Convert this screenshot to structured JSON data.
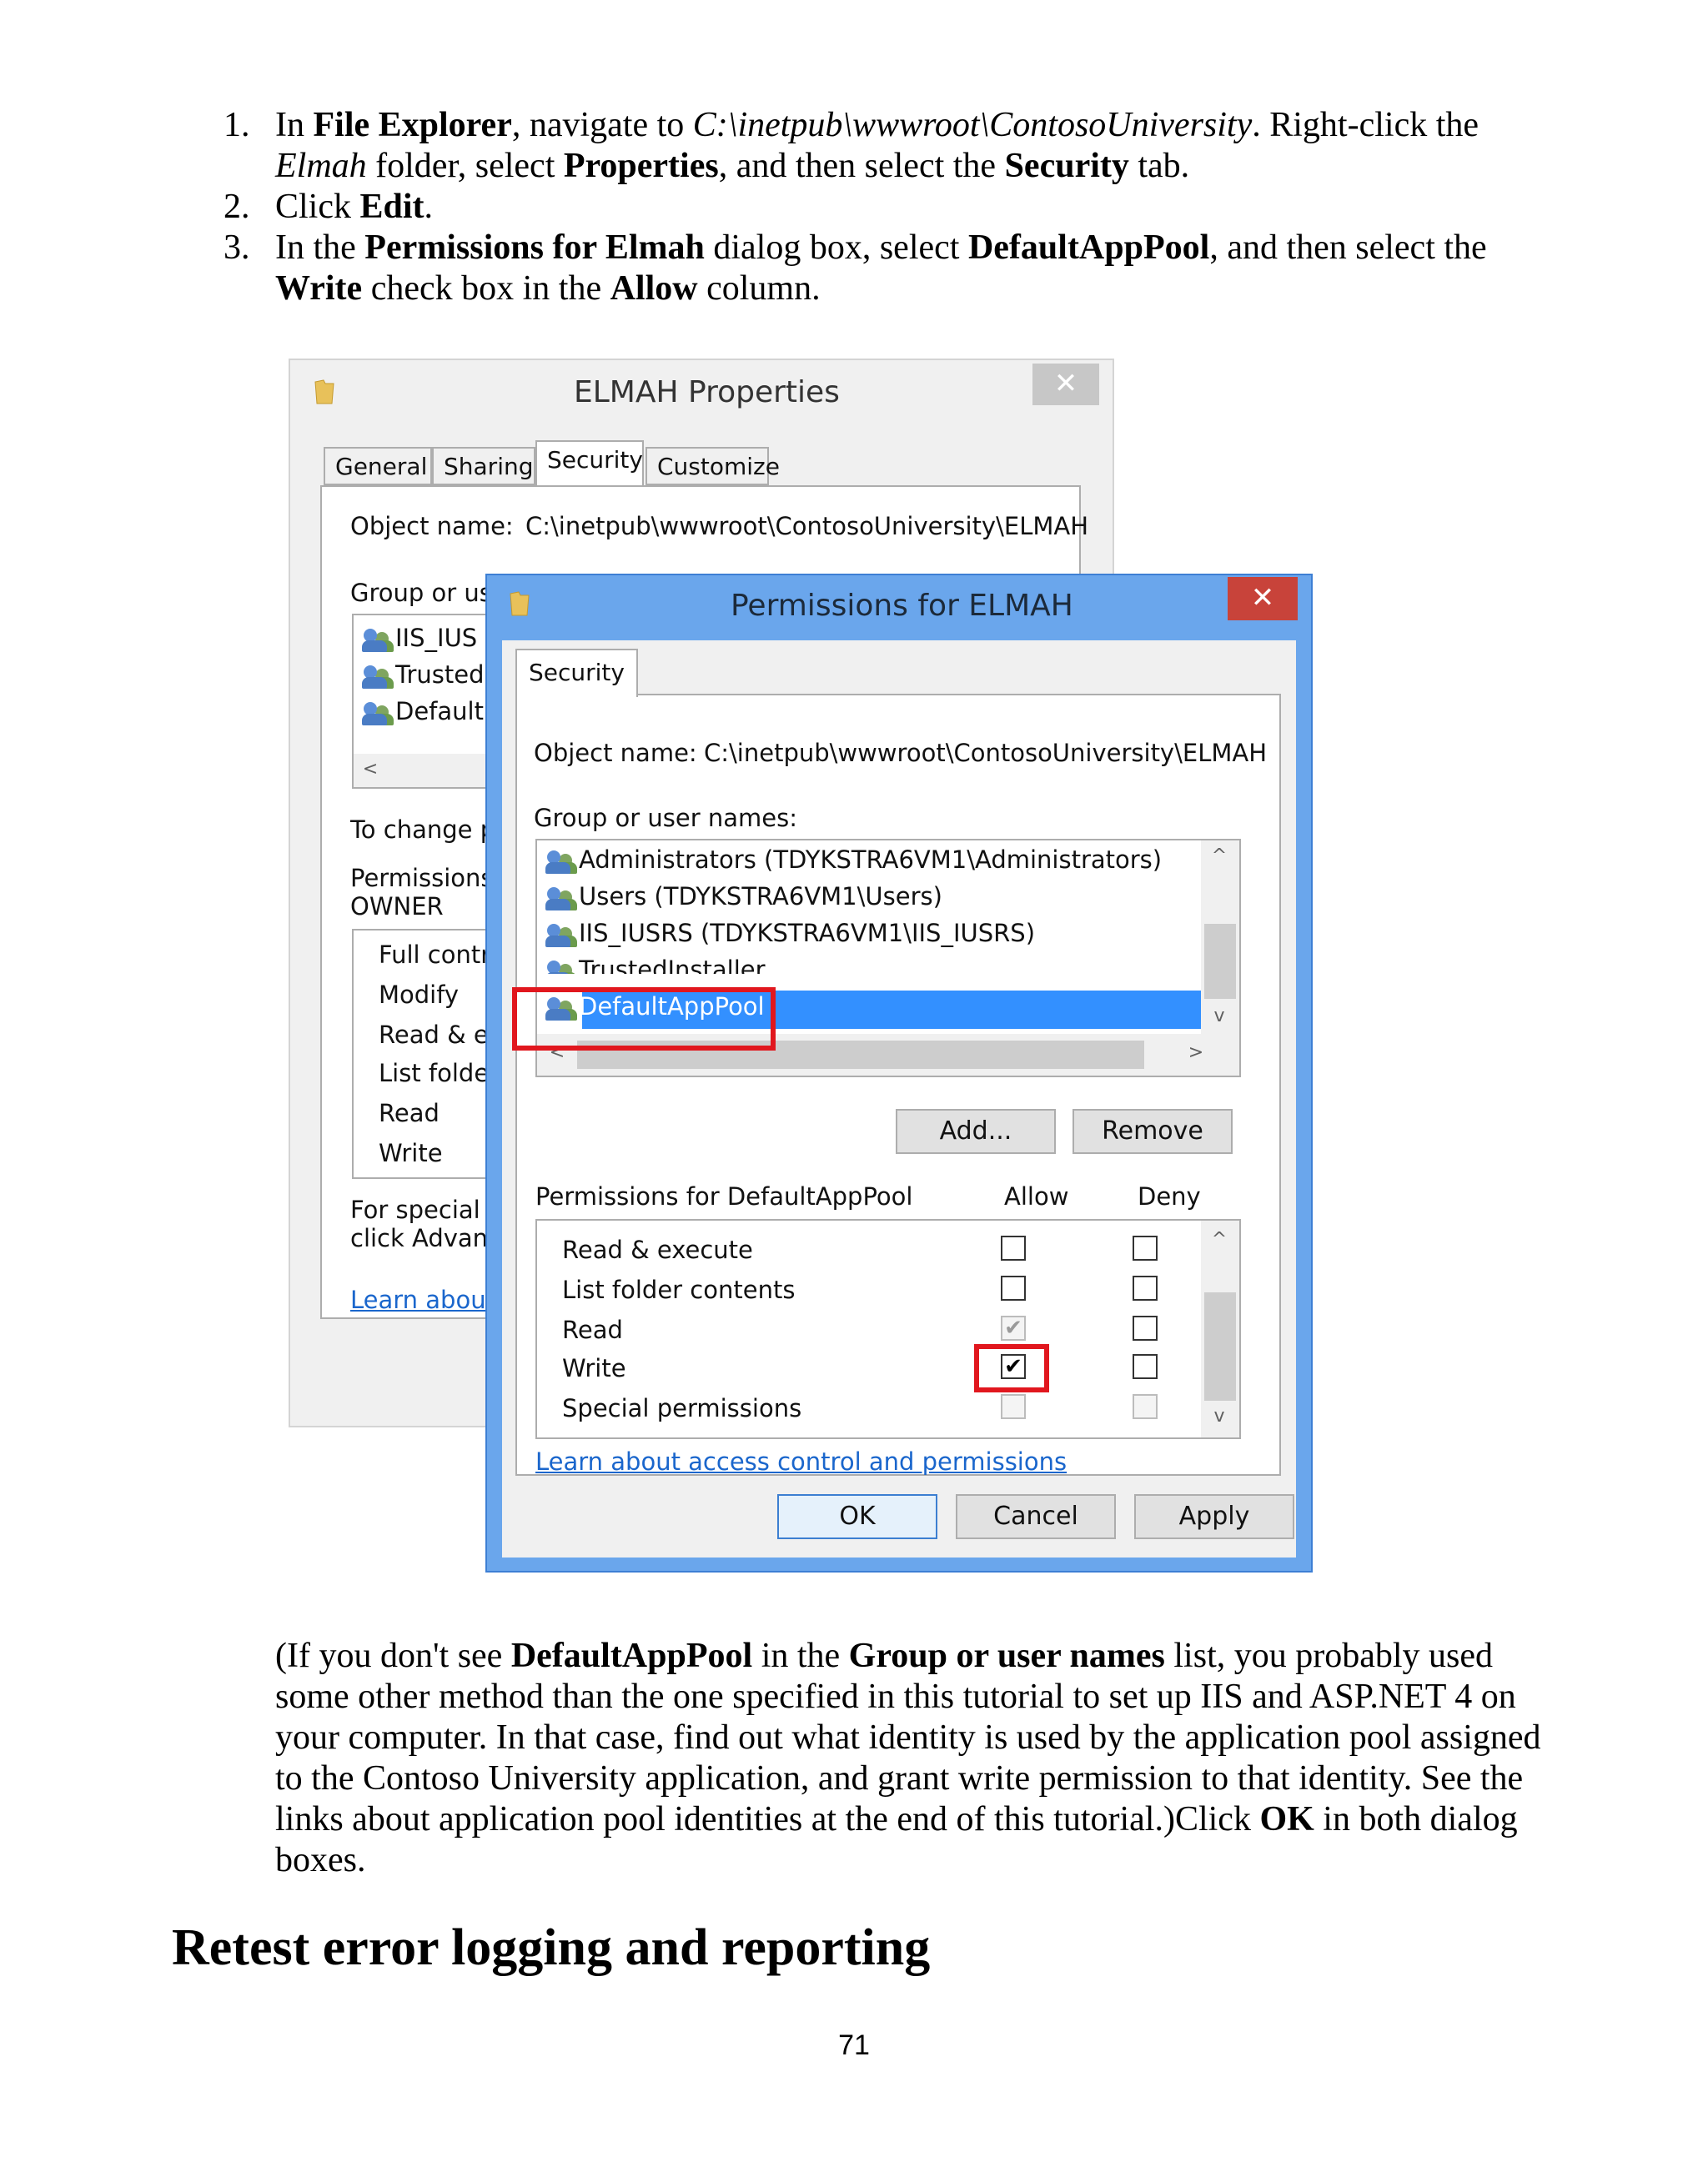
{
  "steps": [
    {
      "num": "1.",
      "p1": "In ",
      "b1": "File Explorer",
      "p2": ", navigate to ",
      "i1": "C:\\inetpub\\wwwroot\\ContosoUniversity",
      "p3": ". Right-click the ",
      "i2": "Elmah",
      "p4": " folder, select ",
      "b2": "Properties",
      "p5": ", and then select the ",
      "b3": "Security",
      "p6": " tab."
    },
    {
      "num": "2.",
      "p1": "Click ",
      "b1": "Edit",
      "p2": "."
    },
    {
      "num": "3.",
      "p1": "In the ",
      "b1": "Permissions for Elmah",
      "p2": " dialog box, select ",
      "b2": "DefaultAppPool",
      "p3": ", and then select the ",
      "b3": "Write",
      "p4": " check box in the ",
      "b4": "Allow",
      "p5": " column."
    }
  ],
  "back_dialog": {
    "title": "ELMAH Properties",
    "close": "✕",
    "tabs": [
      "General",
      "Sharing",
      "Security",
      "Customize"
    ],
    "object_label": "Object name:",
    "object_value": "C:\\inetpub\\wwwroot\\ContosoUniversity\\ELMAH",
    "group_label": "Group or use",
    "users": [
      "IIS_IUS",
      "Trusted",
      "Default"
    ],
    "scroll_left": "<",
    "change_text": "To change p",
    "perm_label_1": "Permissions f",
    "perm_label_2": "OWNER",
    "perms": [
      "Full contro",
      "Modify",
      "Read & ex",
      "List folder",
      "Read",
      "Write"
    ],
    "special_1": "For special p",
    "special_2": "click Advanc",
    "learn": "Learn about"
  },
  "front_dialog": {
    "title": "Permissions for ELMAH",
    "close": "✕",
    "tab": "Security",
    "object_label": "Object name:",
    "object_value": "C:\\inetpub\\wwwroot\\ContosoUniversity\\ELMAH",
    "group_label": "Group or user names:",
    "users": [
      "Administrators (TDYKSTRA6VM1\\Administrators)",
      "Users (TDYKSTRA6VM1\\Users)",
      "IIS_IUSRS (TDYKSTRA6VM1\\IIS_IUSRS)",
      "TrustedInstaller",
      "DefaultAppPool"
    ],
    "add_btn": "Add...",
    "remove_btn": "Remove",
    "perm_for": "Permissions for DefaultAppPool",
    "allow_col": "Allow",
    "deny_col": "Deny",
    "perms": [
      {
        "name": "Read & execute"
      },
      {
        "name": "List folder contents"
      },
      {
        "name": "Read"
      },
      {
        "name": "Write"
      },
      {
        "name": "Special permissions"
      }
    ],
    "learn_link": "Learn about access control and permissions",
    "ok_btn": "OK",
    "cancel_btn": "Cancel",
    "apply_btn": "Apply",
    "up_arrow": "^",
    "down_arrow": "v",
    "left_arrow": "<",
    "right_arrow": ">",
    "check": "✔"
  },
  "para": {
    "p1": "(If you don't see ",
    "b1": "DefaultAppPool",
    "p2": " in the ",
    "b2": "Group or user names",
    "p3": " list, you probably used some other method than the one specified in this tutorial to set up IIS and ASP.NET 4 on your computer. In that case, find out what identity is used by the application pool assigned to the Contoso University application, and grant write permission to that identity. See the links about application pool identities at the end of this tutorial.)Click ",
    "b3": "OK",
    "p4": " in both dialog boxes."
  },
  "heading": "Retest error logging and reporting",
  "page_number": "71"
}
